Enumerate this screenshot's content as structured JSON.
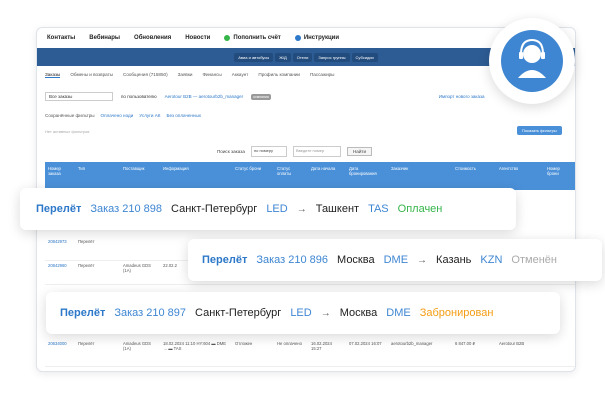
{
  "topbar": {
    "items": [
      "Контакты",
      "Вебинары",
      "Обновления",
      "Новости"
    ],
    "topup": "Пополнить счёт",
    "instructions": "Инструкции"
  },
  "subnav": [
    "Авиа и автобусы",
    "Ж/Д",
    "Отели",
    "Запрос группы",
    "Субсидии"
  ],
  "tabs": [
    "Заказы",
    "Обмены и возвраты",
    "Сообщения (715850)",
    "Заявки",
    "Финансы",
    "Аккаунт",
    "Профиль компании",
    "Пассажиры"
  ],
  "orders_select": "Все заказы",
  "by_user": "по пользователю",
  "user_link": "Aerotour B2B — aerotourb2b_manager",
  "user_badge": "компания",
  "import_link": "Импорт нового заказа",
  "saved_filters": "Сохранённые фильтры",
  "filter_links": [
    "Оплачено ноди",
    "Услуги АК",
    "Без оплаченных"
  ],
  "no_filters": "Нет активных фильтров",
  "show_filters": "Показать фильтры",
  "search": {
    "label": "Поиск заказа",
    "by": "по номеру",
    "placeholder": "Введите номер",
    "button": "Найти"
  },
  "table": {
    "headers": [
      "Номер заказа",
      "Тип",
      "Поставщик",
      "Информация",
      "Статус брони",
      "Статус оплаты",
      "Дата начала",
      "Дата бронирования",
      "Заказчик",
      "Стоимость",
      "Агентство",
      "Номер брони"
    ],
    "rows": [
      [
        "20842973",
        "Перелёт",
        "",
        "",
        "",
        "",
        "",
        "",
        "",
        "",
        "",
        ""
      ],
      [
        "20842960",
        "Перелёт",
        "Amadeus GDS (1A)",
        "22.02.2",
        "",
        "",
        "",
        "",
        "",
        "",
        "",
        ""
      ],
      [
        "20634000",
        "Перелёт",
        "Amadeus GDS (1A)",
        "18.02.2024 11:10 HY:604 ▬ DME → ▬ TAS",
        "Отложен",
        "Не оплачено",
        "16.02.2024 15:27",
        "07.02.2024 16:07",
        "aerotourb2b_manager",
        "6 847.00 ₽",
        "Aerotour B2B",
        ""
      ]
    ]
  },
  "cards": [
    {
      "type": "Перелёт",
      "order": "Заказ 210 898",
      "from": "Санкт-Петербург",
      "from_code": "LED",
      "to": "Ташкент",
      "to_code": "TAS",
      "status": "Оплачен",
      "status_color": "#36b54a"
    },
    {
      "type": "Перелёт",
      "order": "Заказ 210 896",
      "from": "Москва",
      "from_code": "DME",
      "to": "Казань",
      "to_code": "KZN",
      "status": "Отменён",
      "status_color": "#aaaaaa"
    },
    {
      "type": "Перелёт",
      "order": "Заказ 210 897",
      "from": "Санкт-Петербург",
      "from_code": "LED",
      "to": "Москва",
      "to_code": "DME",
      "status": "Забронирован",
      "status_color": "#f39c12"
    }
  ],
  "arrow": "→",
  "colors": {
    "accent": "#2d78c8",
    "header": "#2d5c94",
    "table_head": "#4a90d8"
  }
}
